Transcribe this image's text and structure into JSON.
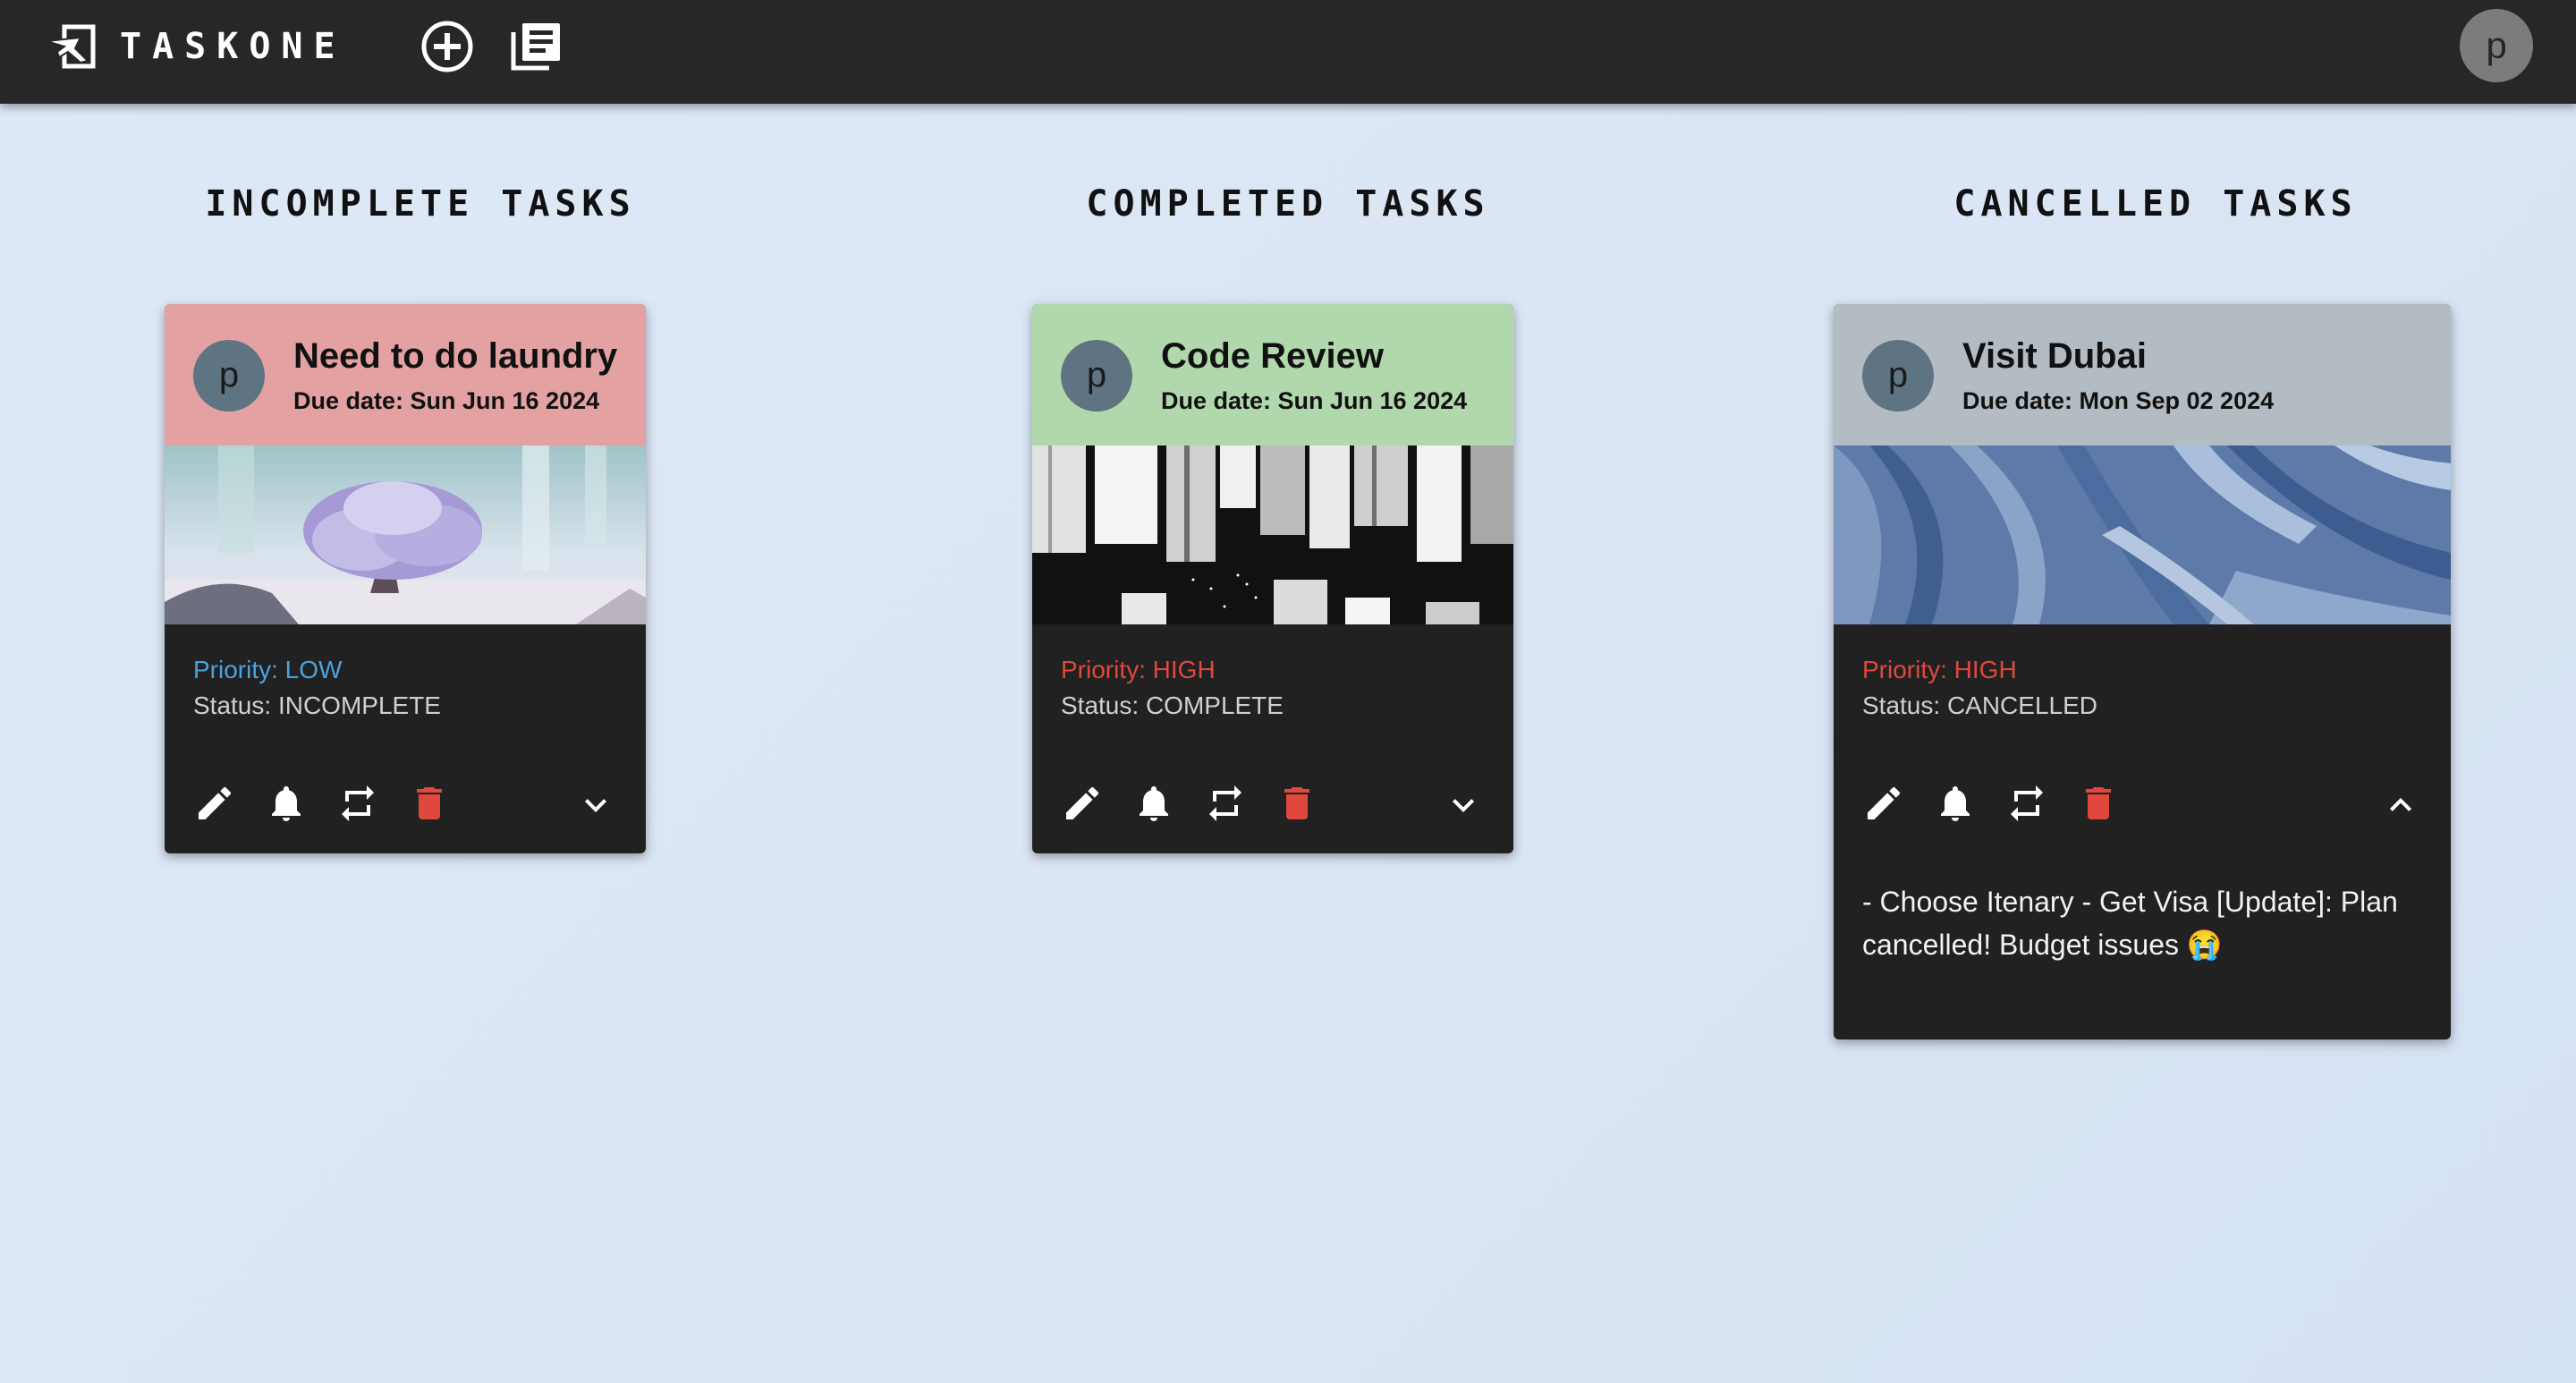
{
  "app": {
    "brand": "TASKONE",
    "profile_initial": "p",
    "icons": {
      "logo": "plane-logo-icon",
      "add": "add-circle-icon",
      "library": "library-books-icon"
    }
  },
  "columns": [
    {
      "title": "INCOMPLETE TASKS"
    },
    {
      "title": "COMPLETED TASKS"
    },
    {
      "title": "CANCELLED TASKS"
    }
  ],
  "cards": [
    {
      "avatar": "p",
      "title": "Need to do laundry",
      "due": "Due date: Sun Jun 16 2024",
      "priority": "Priority: LOW",
      "status": "Status: INCOMPLETE",
      "header_color": "#e4a1a1",
      "priority_color": "#4aa3df",
      "image": "misty-lavender-tree"
    },
    {
      "avatar": "p",
      "title": "Code Review",
      "due": "Due date: Sun Jun 16 2024",
      "priority": "Priority: HIGH",
      "status": "Status: COMPLETE",
      "header_color": "#b1d8ac",
      "priority_color": "#e0483d",
      "image": "black-white-abstract-pillars"
    },
    {
      "avatar": "p",
      "title": "Visit Dubai",
      "due": "Due date: Mon Sep 02 2024",
      "priority": "Priority: HIGH",
      "status": "Status: CANCELLED",
      "header_color": "#b3bcc2",
      "priority_color": "#e0483d",
      "image": "blue-sand-texture",
      "notes": "- Choose Itenary - Get Visa [Update]: Plan cancelled! Budget issues 😭"
    }
  ],
  "card_actions": [
    "edit-icon",
    "bell-icon",
    "repeat-icon",
    "delete-icon"
  ],
  "colors": {
    "topbar": "#272727",
    "card_body": "#212121",
    "delete": "#e0483d"
  }
}
